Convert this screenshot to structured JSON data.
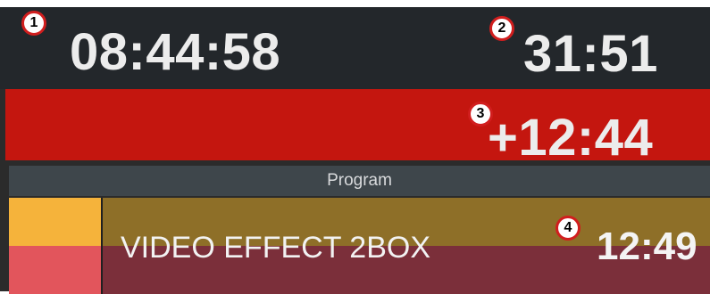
{
  "clock": {
    "time_of_day": "08:44:58",
    "time_of_day_marker": "1",
    "remaining": "31:51",
    "remaining_marker": "2"
  },
  "overrun": {
    "value": "+12:44",
    "marker": "3",
    "color": "#c4160f"
  },
  "section": {
    "label": "Program"
  },
  "item": {
    "title": "VIDEO EFFECT 2BOX",
    "duration": "12:49",
    "marker": "4",
    "colors": {
      "top": "#f5b33b",
      "bottom": "#e2555c"
    }
  }
}
